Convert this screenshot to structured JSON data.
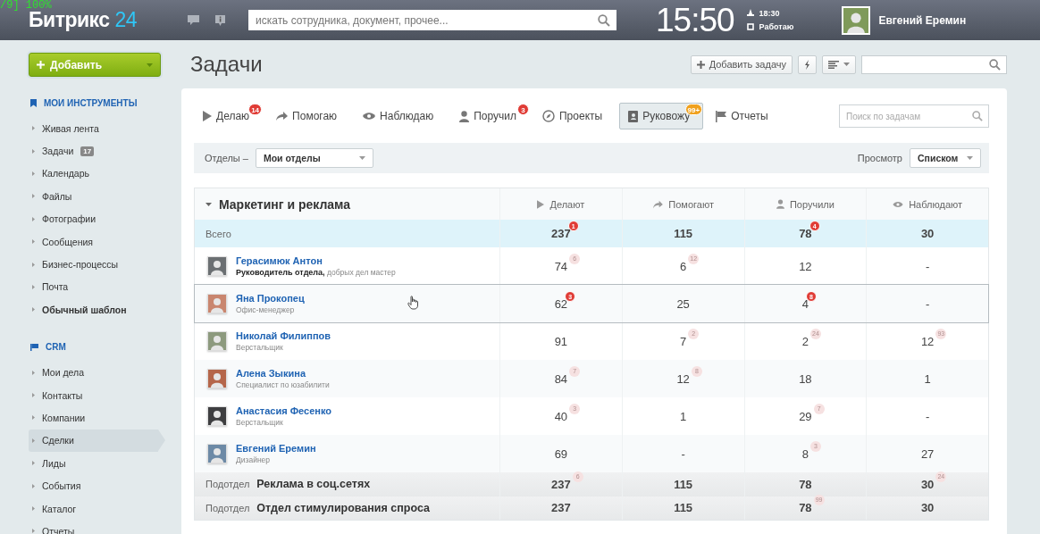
{
  "overlay": "/9] 100%",
  "topbar": {
    "logo": "Битрикс",
    "logo_accent": "24",
    "search": {
      "placeholder": "искать сотрудника, документ, прочее..."
    },
    "clock": "15:50",
    "alarm": "18:30",
    "status": "Работаю",
    "user": "Евгений Еремин"
  },
  "add_button": "Добавить",
  "sidebar": [
    {
      "title": "МОИ ИНСТРУМЕНТЫ",
      "items": [
        {
          "label": "Живая лента",
          "bold": false,
          "selected": false
        },
        {
          "label": "Задачи",
          "badge": "17",
          "bold": false,
          "selected": false
        },
        {
          "label": "Календарь",
          "bold": false,
          "selected": false
        },
        {
          "label": "Файлы",
          "bold": false,
          "selected": false
        },
        {
          "label": "Фотографии",
          "bold": false,
          "selected": false
        },
        {
          "label": "Сообщения",
          "bold": false,
          "selected": false
        },
        {
          "label": "Бизнес-процессы",
          "bold": false,
          "selected": false
        },
        {
          "label": "Почта",
          "bold": false,
          "selected": false
        },
        {
          "label": "Обычный шаблон",
          "bold": true,
          "selected": false
        }
      ]
    },
    {
      "title": "CRM",
      "items": [
        {
          "label": "Мои дела",
          "bold": false,
          "selected": false
        },
        {
          "label": "Контакты",
          "bold": false,
          "selected": false
        },
        {
          "label": "Компании",
          "bold": false,
          "selected": false
        },
        {
          "label": "Сделки",
          "bold": false,
          "selected": true
        },
        {
          "label": "Лиды",
          "bold": false,
          "selected": false
        },
        {
          "label": "События",
          "bold": false,
          "selected": false
        },
        {
          "label": "Каталог",
          "bold": false,
          "selected": false
        },
        {
          "label": "Отчеты",
          "bold": false,
          "selected": false
        }
      ]
    }
  ],
  "page_title": "Задачи",
  "toolbar": {
    "add_task": "Добавить задачу"
  },
  "tabs": [
    {
      "label": "Делаю",
      "badge": "14",
      "color": "#e03c36",
      "selected": false
    },
    {
      "label": "Помогаю",
      "selected": false
    },
    {
      "label": "Наблюдаю",
      "selected": false
    },
    {
      "label": "Поручил",
      "badge": "3",
      "color": "#e03c36",
      "selected": false
    },
    {
      "label": "Проекты",
      "selected": false
    },
    {
      "label": "Руковожу",
      "badge": "99+",
      "color": "#f0a11e",
      "selected": true
    },
    {
      "label": "Отчеты",
      "selected": false
    }
  ],
  "task_search": {
    "placeholder": "Поиск по задачам"
  },
  "filter": {
    "label": "Отделы –",
    "value": "Мои отделы",
    "view_label": "Просмотр",
    "view_value": "Списком"
  },
  "table": {
    "title": "Маркетинг и реклама",
    "expanded": true,
    "columns": [
      "Делают",
      "Помогают",
      "Поручили",
      "Наблюдают"
    ],
    "rows": [
      {
        "kind": "total",
        "label": "Всего",
        "cells": [
          {
            "value": "237",
            "badge": "1",
            "alert": true
          },
          {
            "value": "115"
          },
          {
            "value": "78",
            "badge": "4",
            "alert": true
          },
          {
            "value": "30"
          }
        ]
      },
      {
        "kind": "person",
        "name": "Герасимюк Антон",
        "role": "Руководитель отдела,",
        "note": "добрых дел мастер",
        "hovered": false,
        "cells": [
          {
            "value": "74",
            "badge": "6",
            "alert": false
          },
          {
            "value": "6",
            "badge": "12",
            "alert": false
          },
          {
            "value": "12"
          },
          {
            "value": "-"
          }
        ]
      },
      {
        "kind": "person",
        "name": "Яна Прокопец",
        "role": "Офис-менеджер",
        "hovered": true,
        "cells": [
          {
            "value": "62",
            "badge": "3",
            "alert": true
          },
          {
            "value": "25"
          },
          {
            "value": "4",
            "badge": "8",
            "alert": true
          },
          {
            "value": "-"
          }
        ]
      },
      {
        "kind": "person",
        "name": "Николай Филиппов",
        "role": "Верстальщик",
        "hovered": false,
        "cells": [
          {
            "value": "91"
          },
          {
            "value": "7",
            "badge": "2",
            "alert": false
          },
          {
            "value": "2",
            "badge": "24",
            "alert": false
          },
          {
            "value": "12",
            "badge": "93",
            "alert": false
          }
        ]
      },
      {
        "kind": "person",
        "name": "Алена Зыкина",
        "role": "Специалист по юзабилити",
        "hovered": false,
        "cells": [
          {
            "value": "84",
            "badge": "7",
            "alert": false
          },
          {
            "value": "12",
            "badge": "8",
            "alert": false
          },
          {
            "value": "18"
          },
          {
            "value": "1"
          }
        ]
      },
      {
        "kind": "person",
        "name": "Анастасия Фесенко",
        "role": "Верстальщик",
        "hovered": false,
        "cells": [
          {
            "value": "40",
            "badge": "3",
            "alert": false
          },
          {
            "value": "1"
          },
          {
            "value": "29",
            "badge": "7",
            "alert": false
          },
          {
            "value": "-"
          }
        ]
      },
      {
        "kind": "person",
        "name": "Евгений Еремин",
        "role": "Дизайнер",
        "hovered": false,
        "cells": [
          {
            "value": "69"
          },
          {
            "value": "-"
          },
          {
            "value": "8",
            "badge": "3",
            "alert": false
          },
          {
            "value": "27"
          }
        ]
      },
      {
        "kind": "subdept",
        "prefix": "Подотдел",
        "label": "Реклама в соц.сетях",
        "cells": [
          {
            "value": "237",
            "badge": "6",
            "alert": false
          },
          {
            "value": "115"
          },
          {
            "value": "78"
          },
          {
            "value": "30",
            "badge": "24",
            "alert": false
          }
        ]
      },
      {
        "kind": "subdept",
        "prefix": "Подотдел",
        "label": "Отдел стимулирования спроса",
        "cells": [
          {
            "value": "237"
          },
          {
            "value": "115"
          },
          {
            "value": "78",
            "badge": "99",
            "alert": false
          },
          {
            "value": "30"
          }
        ]
      }
    ]
  }
}
